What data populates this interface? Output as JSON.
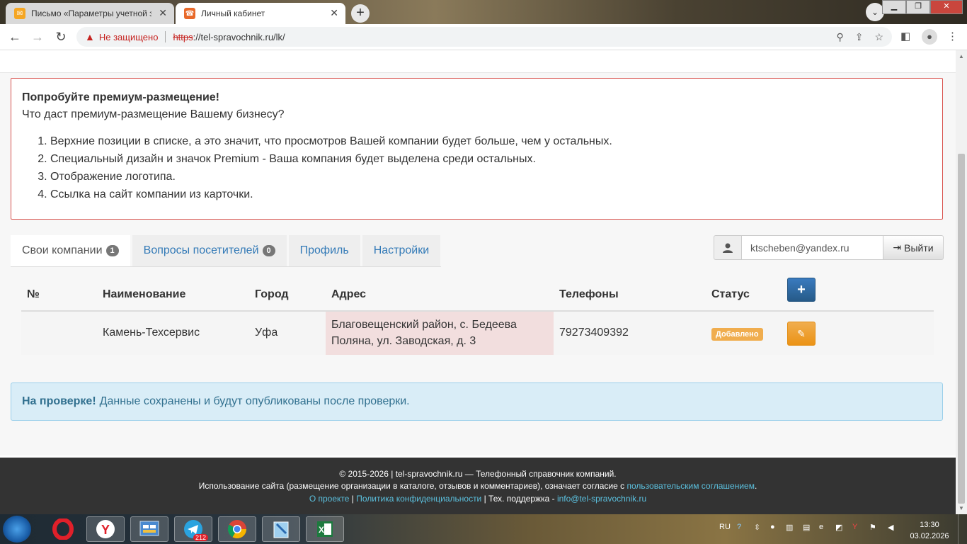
{
  "browser": {
    "tabs": [
      {
        "title": "Письмо «Параметры учетной за",
        "active": false,
        "favicon": "mail-icon"
      },
      {
        "title": "Личный кабинет",
        "active": true,
        "favicon": "phone-icon"
      }
    ],
    "address": {
      "security_label": "Не защищено",
      "scheme": "https",
      "rest": "://tel-spravochnik.ru/lk/"
    }
  },
  "promo": {
    "heading": "Попробуйте премиум-размещение!",
    "subheading": "Что даст премиум-размещение Вашему бизнесу?",
    "items": [
      "Верхние позиции в списке, а это значит, что просмотров Вашей компании будет больше, чем у остальных.",
      "Специальный дизайн и значок Premium - Ваша компания будет выделена среди остальных.",
      "Отображение логотипа.",
      "Ссылка на сайт компании из карточки."
    ]
  },
  "tabs": [
    {
      "label": "Свои компании",
      "badge": "1"
    },
    {
      "label": "Вопросы посетителей",
      "badge": "0"
    },
    {
      "label": "Профиль"
    },
    {
      "label": "Настройки"
    }
  ],
  "user": {
    "email": "ktscheben@yandex.ru",
    "logout_label": "Выйти"
  },
  "table": {
    "headers": [
      "№",
      "Наименование",
      "Город",
      "Адрес",
      "Телефоны",
      "Статус"
    ],
    "rows": [
      {
        "num": "",
        "name": "Камень-Техсервис",
        "city": "Уфа",
        "address_line1": "Благовещенский район, с. Бедеева",
        "address_line2": "Поляна, ул. Заводская, д. 3",
        "phone": "79273409392",
        "status": "Добавлено"
      }
    ]
  },
  "alert": {
    "strong": "На проверке!",
    "text": "Данные сохранены и будут опубликованы после проверки."
  },
  "footer": {
    "line1": "© 2015-2026 | tel-spravochnik.ru — Телефонный справочник компаний.",
    "line2_text": "Использование сайта (размещение организации в каталоге, отзывов и комментариев), означает согласие с ",
    "line2_link": "пользовательским соглашением",
    "line2_end": ".",
    "about": "О проекте",
    "privacy": "Политика конфиденциальности",
    "support_label": " | Тех. поддержка - ",
    "support_email": "info@tel-spravochnik.ru"
  },
  "taskbar": {
    "lang": "RU",
    "time": "13:30",
    "date": "03.02.2026",
    "telegram_badge": "212",
    "apps": [
      "opera-icon",
      "yandex-browser-icon",
      "control-panel-icon",
      "telegram-icon",
      "chrome-icon",
      "notepad-icon",
      "excel-icon"
    ]
  },
  "colors": {
    "link": "#337ab7",
    "danger_border": "#d9534f",
    "warning": "#f0ad4e",
    "primary": "#337ab7",
    "info_bg": "#d9edf7"
  }
}
